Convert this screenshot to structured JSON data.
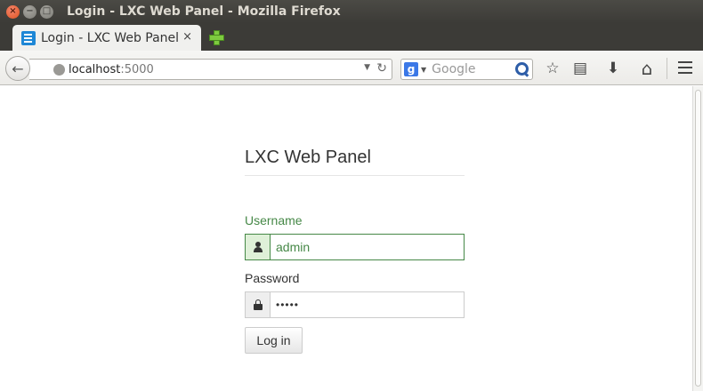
{
  "window": {
    "title": "Login - LXC Web Panel - Mozilla Firefox",
    "close_glyph": "×",
    "minimize_glyph": "−",
    "maximize_glyph": "□"
  },
  "tab": {
    "title": "Login - LXC Web Panel",
    "close_glyph": "×",
    "favicon": "lxc-favicon-icon"
  },
  "navbar": {
    "back_glyph": "←",
    "url_host": "localhost",
    "url_port": ":5000",
    "url_drop_glyph": "▼",
    "reload_glyph": "↻",
    "search_engine_glyph": "g",
    "search_drop_glyph": "▼",
    "search_placeholder": "Google",
    "bookmark_glyph": "☆",
    "bookmarks_menu_glyph": "▤",
    "downloads_glyph": "⬇",
    "home_glyph": "⌂"
  },
  "login": {
    "title": "LXC Web Panel",
    "username_label": "Username",
    "username_value": "admin",
    "password_label": "Password",
    "password_value": "•••••",
    "submit_label": "Log in"
  },
  "colors": {
    "success": "#468847",
    "success_bg": "#dff0d8",
    "titlebar": "#3c3b37"
  }
}
